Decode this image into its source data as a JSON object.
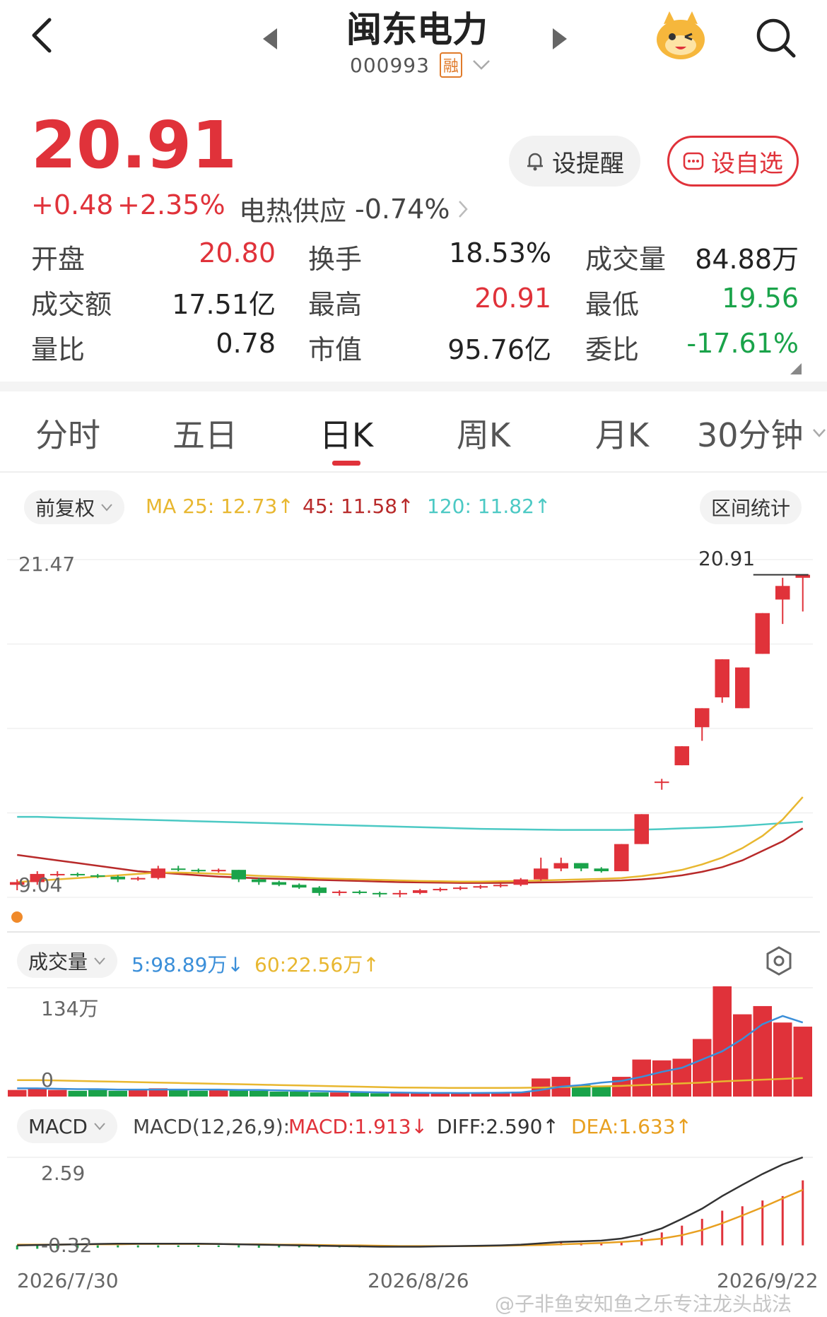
{
  "header": {
    "title": "闽东电力",
    "code": "000993",
    "badge": "融"
  },
  "quote": {
    "price": "20.91",
    "change": "+0.48",
    "change_pct": "+2.35%",
    "sector": "电热供应",
    "sector_pct": "-0.74%",
    "remind_label": "设提醒",
    "watch_label": "设自选"
  },
  "stats": [
    {
      "label": "开盘",
      "value": "20.80",
      "color": "red"
    },
    {
      "label": "换手",
      "value": "18.53%",
      "color": "dark"
    },
    {
      "label": "成交量",
      "value": "84.88万",
      "color": "dark"
    },
    {
      "label": "成交额",
      "value": "17.51亿",
      "color": "dark"
    },
    {
      "label": "最高",
      "value": "20.91",
      "color": "red"
    },
    {
      "label": "最低",
      "value": "19.56",
      "color": "green"
    },
    {
      "label": "量比",
      "value": "0.78",
      "color": "dark"
    },
    {
      "label": "市值",
      "value": "95.76亿",
      "color": "dark"
    },
    {
      "label": "委比",
      "value": "-17.61%",
      "color": "green"
    }
  ],
  "tabs": [
    "分时",
    "五日",
    "日K",
    "周K",
    "月K",
    "30分钟"
  ],
  "active_tab": "日K",
  "kline": {
    "adjust_label": "前复权",
    "ma25": "MA 25: 12.73↑",
    "ma45": "45: 11.58↑",
    "ma120": "120: 11.82↑",
    "range_stat": "区间统计",
    "max_label": "21.47",
    "min_label": "9.04",
    "high_marker": "20.91",
    "colors": {
      "up": "#e0323a",
      "down": "#1aa34a",
      "ma25": "#e8b730",
      "ma45": "#b82a2a",
      "ma120": "#4cc9c4"
    }
  },
  "volume": {
    "label": "成交量",
    "ma5": "5:98.89万↓",
    "ma60": "60:22.56万↑",
    "max_label": "134万",
    "min_label": "0"
  },
  "macd": {
    "label": "MACD",
    "params": "MACD(12,26,9):",
    "macd": "MACD:1.913↓",
    "diff": "DIFF:2.590↑",
    "dea": "DEA:1.633↑",
    "max_label": "2.59",
    "min_label": "-0.32"
  },
  "dates": [
    "2026/7/30",
    "2026/8/26",
    "2026/9/22"
  ],
  "watermark": "@子非鱼安知鱼之乐专注龙头战法",
  "chart_data": {
    "type": "candlestick",
    "x": [
      "2026/7/30",
      "2026/8/26",
      "2026/9/22"
    ],
    "ylim": [
      9.04,
      21.47
    ],
    "candles": [
      {
        "o": 9.5,
        "c": 9.6,
        "h": 9.7,
        "l": 9.3
      },
      {
        "o": 9.6,
        "c": 9.9,
        "h": 10.0,
        "l": 9.5
      },
      {
        "o": 9.9,
        "c": 9.9,
        "h": 10.0,
        "l": 9.8
      },
      {
        "o": 9.9,
        "c": 9.85,
        "h": 9.95,
        "l": 9.8
      },
      {
        "o": 9.85,
        "c": 9.8,
        "h": 9.9,
        "l": 9.75
      },
      {
        "o": 9.8,
        "c": 9.7,
        "h": 9.85,
        "l": 9.6
      },
      {
        "o": 9.7,
        "c": 9.75,
        "h": 9.8,
        "l": 9.65
      },
      {
        "o": 9.75,
        "c": 10.1,
        "h": 10.2,
        "l": 9.7
      },
      {
        "o": 10.1,
        "c": 10.05,
        "h": 10.2,
        "l": 10.0
      },
      {
        "o": 10.05,
        "c": 10.0,
        "h": 10.1,
        "l": 9.95
      },
      {
        "o": 10.0,
        "c": 10.05,
        "h": 10.1,
        "l": 9.95
      },
      {
        "o": 10.05,
        "c": 9.7,
        "h": 10.05,
        "l": 9.6
      },
      {
        "o": 9.7,
        "c": 9.6,
        "h": 9.75,
        "l": 9.5
      },
      {
        "o": 9.6,
        "c": 9.5,
        "h": 9.65,
        "l": 9.45
      },
      {
        "o": 9.5,
        "c": 9.4,
        "h": 9.55,
        "l": 9.35
      },
      {
        "o": 9.4,
        "c": 9.2,
        "h": 9.45,
        "l": 9.1
      },
      {
        "o": 9.2,
        "c": 9.25,
        "h": 9.3,
        "l": 9.1
      },
      {
        "o": 9.25,
        "c": 9.2,
        "h": 9.3,
        "l": 9.15
      },
      {
        "o": 9.2,
        "c": 9.18,
        "h": 9.25,
        "l": 9.05
      },
      {
        "o": 9.18,
        "c": 9.2,
        "h": 9.3,
        "l": 9.04
      },
      {
        "o": 9.2,
        "c": 9.3,
        "h": 9.35,
        "l": 9.15
      },
      {
        "o": 9.3,
        "c": 9.35,
        "h": 9.4,
        "l": 9.25
      },
      {
        "o": 9.35,
        "c": 9.4,
        "h": 9.45,
        "l": 9.3
      },
      {
        "o": 9.4,
        "c": 9.45,
        "h": 9.5,
        "l": 9.35
      },
      {
        "o": 9.45,
        "c": 9.5,
        "h": 9.55,
        "l": 9.4
      },
      {
        "o": 9.5,
        "c": 9.7,
        "h": 9.75,
        "l": 9.45
      },
      {
        "o": 9.7,
        "c": 10.1,
        "h": 10.5,
        "l": 9.65
      },
      {
        "o": 10.1,
        "c": 10.3,
        "h": 10.5,
        "l": 10.0
      },
      {
        "o": 10.3,
        "c": 10.1,
        "h": 10.3,
        "l": 10.0
      },
      {
        "o": 10.1,
        "c": 10.0,
        "h": 10.15,
        "l": 9.95
      },
      {
        "o": 10.0,
        "c": 11.0,
        "h": 11.0,
        "l": 10.0
      },
      {
        "o": 11.0,
        "c": 12.1,
        "h": 12.1,
        "l": 11.0
      },
      {
        "o": 13.3,
        "c": 13.3,
        "h": 13.4,
        "l": 13.0
      },
      {
        "o": 13.9,
        "c": 14.6,
        "h": 14.6,
        "l": 13.9
      },
      {
        "o": 15.3,
        "c": 16.0,
        "h": 16.0,
        "l": 14.8
      },
      {
        "o": 16.4,
        "c": 17.8,
        "h": 17.8,
        "l": 16.2
      },
      {
        "o": 16.0,
        "c": 17.5,
        "h": 17.5,
        "l": 16.0
      },
      {
        "o": 18.0,
        "c": 19.5,
        "h": 19.5,
        "l": 18.0
      },
      {
        "o": 20.0,
        "c": 20.5,
        "h": 20.8,
        "l": 19.1
      },
      {
        "o": 20.8,
        "c": 20.91,
        "h": 20.91,
        "l": 19.56
      }
    ],
    "ma120": [
      12.0,
      12.0,
      11.98,
      11.96,
      11.94,
      11.92,
      11.9,
      11.88,
      11.86,
      11.84,
      11.82,
      11.8,
      11.78,
      11.76,
      11.74,
      11.72,
      11.7,
      11.68,
      11.66,
      11.64,
      11.62,
      11.6,
      11.58,
      11.56,
      11.55,
      11.54,
      11.53,
      11.52,
      11.52,
      11.52,
      11.52,
      11.53,
      11.55,
      11.58,
      11.6,
      11.63,
      11.67,
      11.72,
      11.77,
      11.82
    ],
    "ma25": [
      9.6,
      9.65,
      9.7,
      9.75,
      9.8,
      9.85,
      9.9,
      9.95,
      9.95,
      9.93,
      9.9,
      9.87,
      9.83,
      9.8,
      9.77,
      9.74,
      9.72,
      9.7,
      9.68,
      9.66,
      9.64,
      9.63,
      9.62,
      9.62,
      9.63,
      9.64,
      9.66,
      9.68,
      9.7,
      9.72,
      9.75,
      9.82,
      9.92,
      10.05,
      10.25,
      10.5,
      10.85,
      11.3,
      11.9,
      12.73
    ],
    "ma45": [
      10.6,
      10.5,
      10.4,
      10.3,
      10.2,
      10.1,
      10.0,
      9.95,
      9.9,
      9.85,
      9.8,
      9.77,
      9.74,
      9.72,
      9.7,
      9.68,
      9.66,
      9.64,
      9.62,
      9.6,
      9.59,
      9.58,
      9.57,
      9.57,
      9.57,
      9.58,
      9.59,
      9.6,
      9.62,
      9.64,
      9.66,
      9.7,
      9.76,
      9.85,
      9.98,
      10.15,
      10.4,
      10.75,
      11.1,
      11.58
    ],
    "volume_ylim": [
      0,
      134
    ],
    "volume": [
      8,
      9,
      8,
      7,
      8,
      7,
      9,
      10,
      8,
      7,
      9,
      8,
      7,
      6,
      6,
      5,
      5,
      5,
      4,
      4,
      4,
      4,
      4,
      5,
      5,
      6,
      22,
      24,
      14,
      12,
      24,
      45,
      44,
      46,
      70,
      134,
      100,
      110,
      90,
      85
    ],
    "vol_ma5": [
      10,
      10,
      9.5,
      9,
      9,
      8.5,
      8.5,
      8.5,
      8.5,
      8.5,
      8.5,
      8,
      8,
      7.5,
      7,
      6.5,
      6,
      5.5,
      5,
      4.8,
      4.5,
      4.4,
      4.3,
      4.4,
      4.6,
      5,
      8,
      12,
      14,
      17,
      19,
      24,
      30,
      35,
      45,
      55,
      70,
      88,
      98,
      90
    ],
    "vol_ma60": [
      20,
      20,
      19.5,
      19,
      18.5,
      18,
      17.5,
      17,
      16.5,
      16,
      15.5,
      15,
      14.5,
      14,
      13.5,
      13,
      12.5,
      12,
      11.5,
      11,
      10.8,
      10.6,
      10.5,
      10.5,
      10.5,
      10.6,
      11,
      11.5,
      12,
      12.5,
      13,
      14,
      15,
      16,
      17,
      18.5,
      19.5,
      20.5,
      21.5,
      22.56
    ],
    "macd_ylim": [
      -0.32,
      2.59
    ],
    "macd_hist": [
      -0.12,
      -0.1,
      -0.1,
      -0.08,
      -0.07,
      -0.06,
      -0.06,
      -0.06,
      -0.05,
      -0.05,
      -0.05,
      -0.06,
      -0.07,
      -0.06,
      -0.06,
      -0.06,
      -0.06,
      -0.06,
      -0.05,
      -0.05,
      -0.04,
      -0.04,
      -0.03,
      -0.02,
      -0.02,
      0.02,
      0.05,
      0.08,
      0.08,
      0.08,
      0.12,
      0.22,
      0.38,
      0.58,
      0.78,
      1.02,
      1.15,
      1.32,
      1.45,
      1.913
    ],
    "diff": [
      0.0,
      0.01,
      0.02,
      0.03,
      0.04,
      0.05,
      0.05,
      0.05,
      0.05,
      0.05,
      0.04,
      0.03,
      0.02,
      0.01,
      0.0,
      -0.01,
      -0.02,
      -0.03,
      -0.04,
      -0.04,
      -0.04,
      -0.03,
      -0.02,
      -0.01,
      0.0,
      0.02,
      0.06,
      0.1,
      0.12,
      0.14,
      0.2,
      0.32,
      0.5,
      0.78,
      1.08,
      1.45,
      1.78,
      2.1,
      2.38,
      2.59
    ],
    "dea": [
      0.02,
      0.02,
      0.02,
      0.03,
      0.03,
      0.03,
      0.04,
      0.04,
      0.04,
      0.04,
      0.04,
      0.03,
      0.03,
      0.02,
      0.02,
      0.01,
      0.0,
      0.0,
      -0.01,
      -0.02,
      -0.02,
      -0.02,
      -0.02,
      -0.02,
      -0.01,
      0.0,
      0.01,
      0.03,
      0.05,
      0.07,
      0.1,
      0.14,
      0.2,
      0.3,
      0.45,
      0.65,
      0.88,
      1.12,
      1.38,
      1.633
    ]
  }
}
